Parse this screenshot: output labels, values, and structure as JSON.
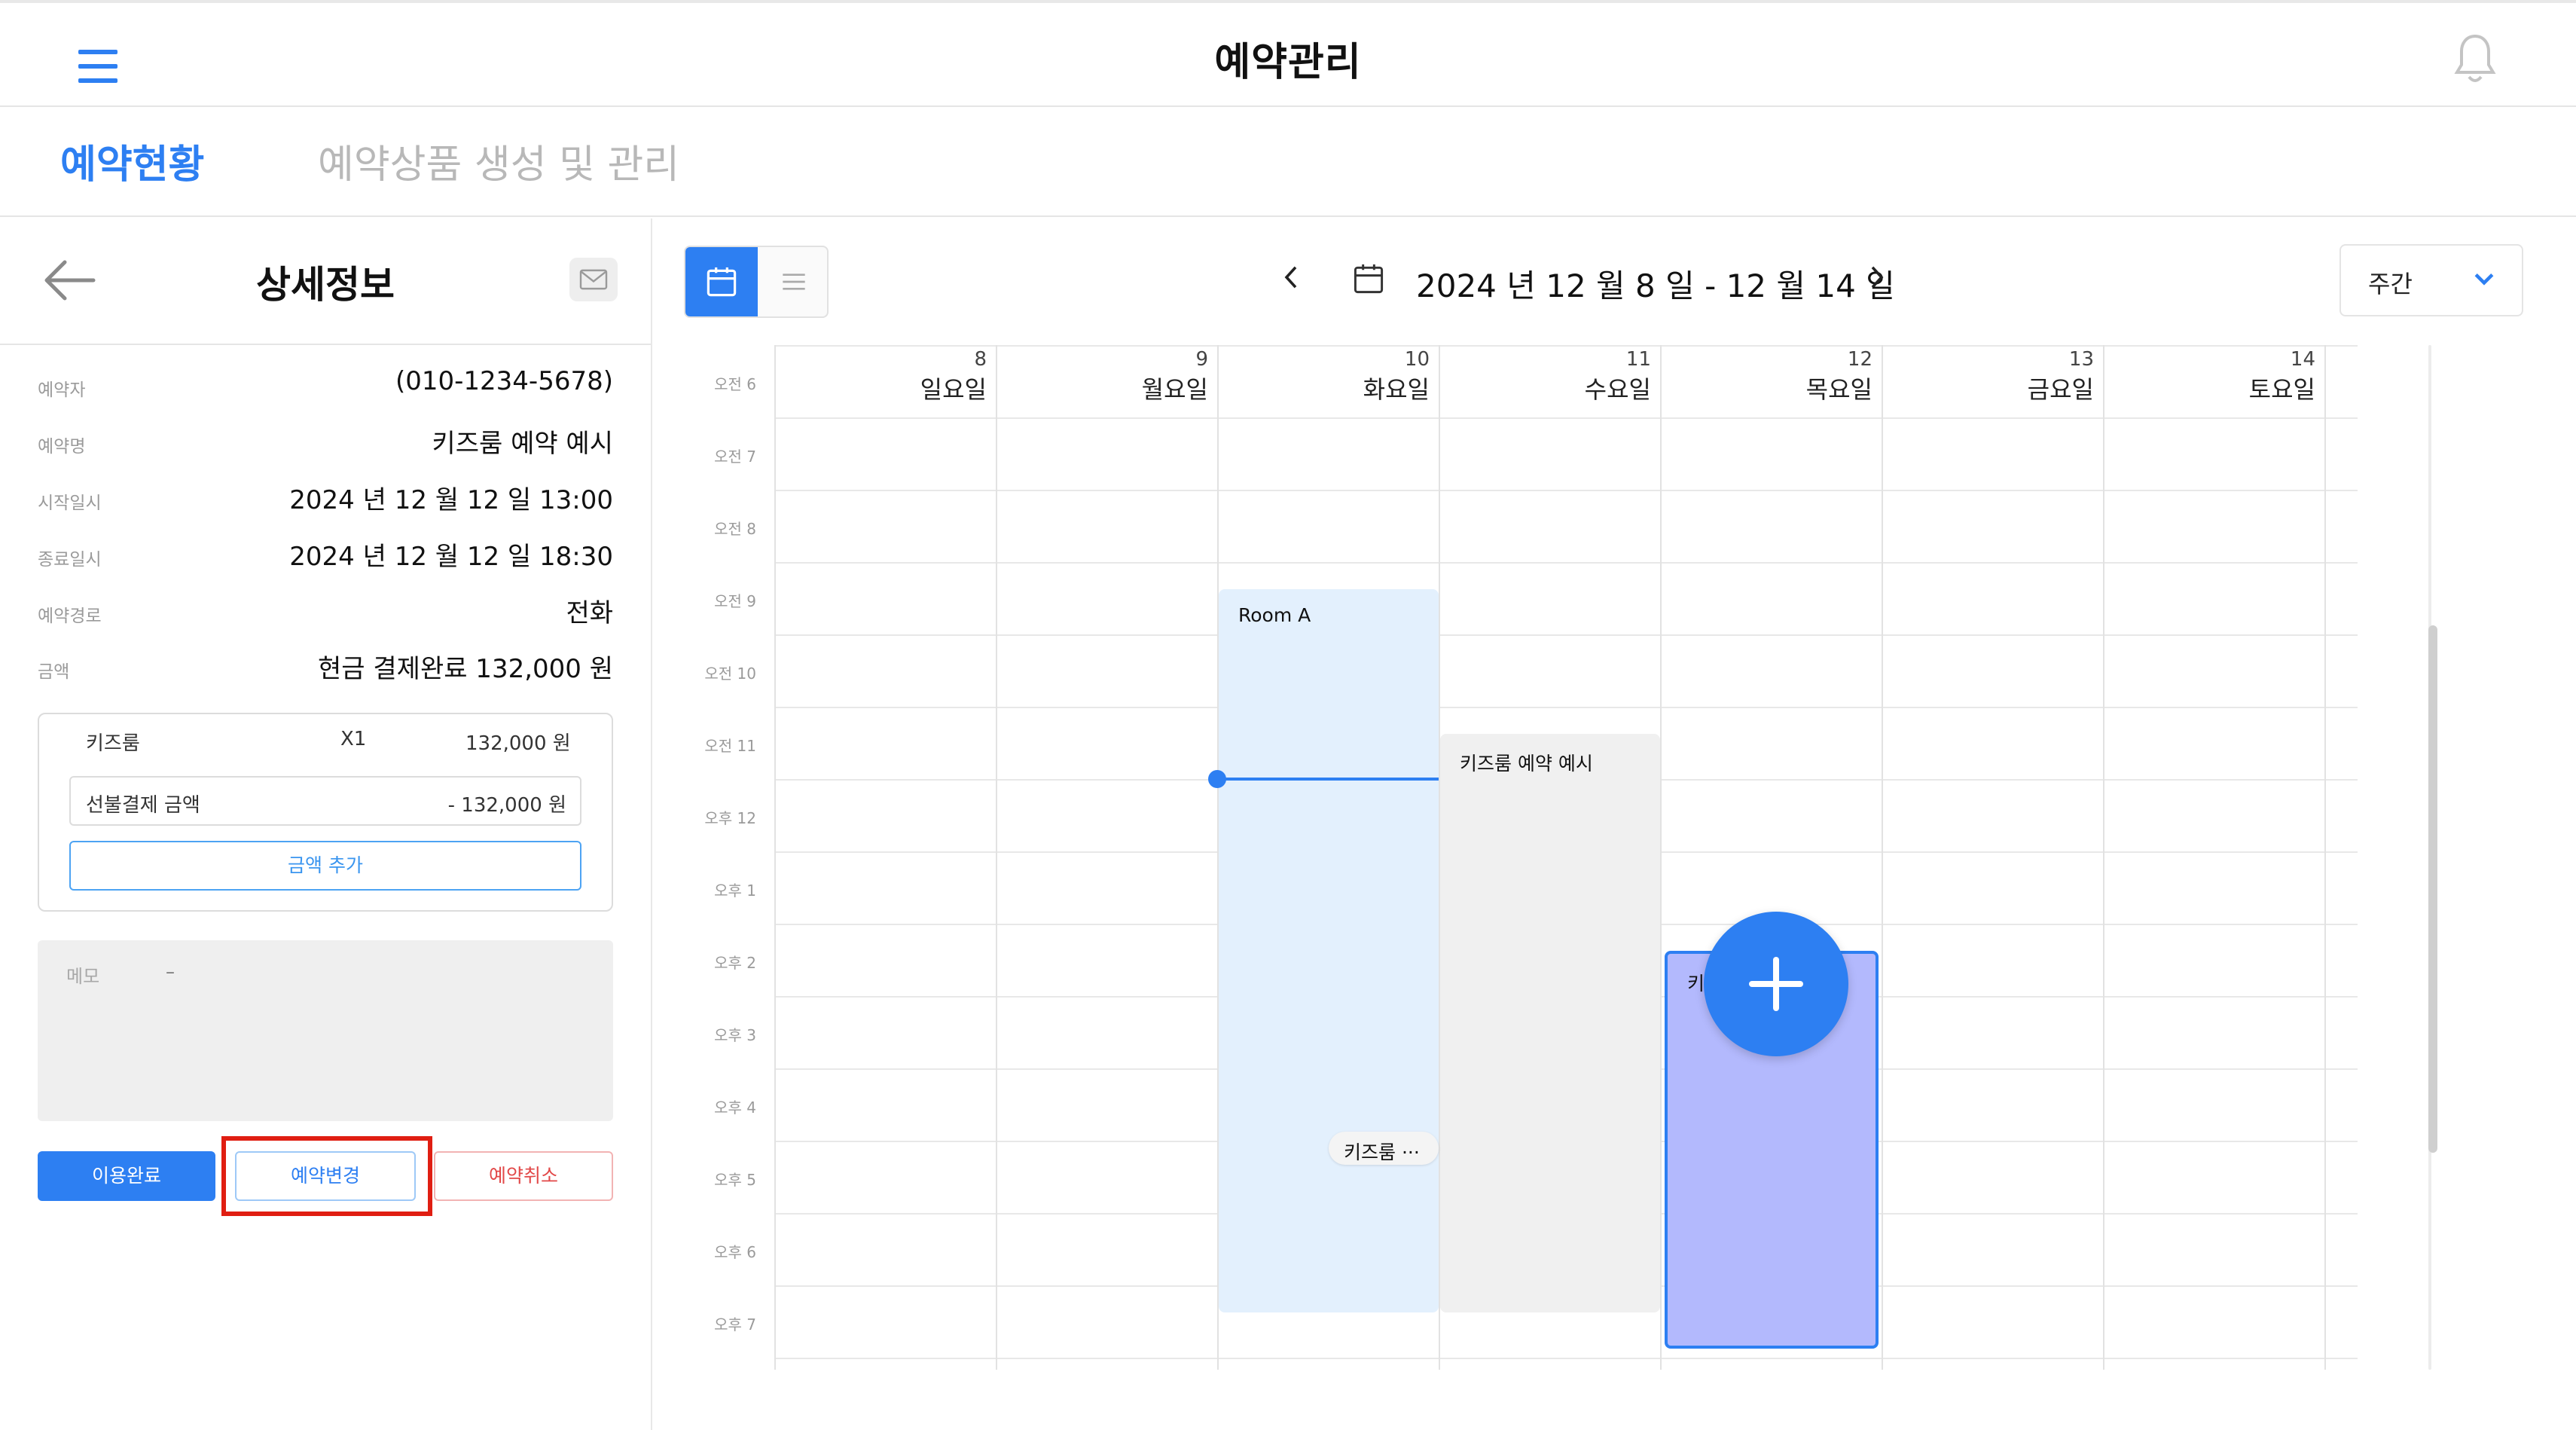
{
  "app": {
    "title": "예약관리"
  },
  "tabs": [
    {
      "label": "예약현황",
      "active": true
    },
    {
      "label": "예약상품 생성 및 관리",
      "active": false
    }
  ],
  "detail": {
    "title": "상세정보",
    "rows": [
      {
        "label": "예약자",
        "value": "(010-1234-5678)"
      },
      {
        "label": "예약명",
        "value": "키즈룸 예약 예시"
      },
      {
        "label": "시작일시",
        "value": "2024 년 12 월 12 일 13:00"
      },
      {
        "label": "종료일시",
        "value": "2024 년 12 월 12 일 18:30"
      },
      {
        "label": "예약경로",
        "value": "전화"
      },
      {
        "label": "금액",
        "value": "현금 결제완료 132,000 원"
      }
    ],
    "price": {
      "item_name": "키즈룸",
      "item_qty": "X1",
      "item_amount": "132,000 원",
      "prepaid_label": "선불결제 금액",
      "prepaid_amount": "- 132,000 원",
      "add_button": "금액 추가"
    },
    "memo": {
      "label": "메모",
      "value": "–"
    },
    "actions": {
      "complete": "이용완료",
      "change": "예약변경",
      "cancel": "예약취소"
    }
  },
  "calendar": {
    "date_range": "2024 년 12 월 8 일 - 12 월 14 일",
    "period": "주간",
    "days": [
      {
        "num": "8",
        "name": "일요일"
      },
      {
        "num": "9",
        "name": "월요일"
      },
      {
        "num": "10",
        "name": "화요일"
      },
      {
        "num": "11",
        "name": "수요일"
      },
      {
        "num": "12",
        "name": "목요일"
      },
      {
        "num": "13",
        "name": "금요일"
      },
      {
        "num": "14",
        "name": "토요일"
      }
    ],
    "hours": [
      "오전 6",
      "오전 7",
      "오전 8",
      "오전 9",
      "오전 10",
      "오전 11",
      "오후 12",
      "오후 1",
      "오후 2",
      "오후 3",
      "오후 4",
      "오후 5",
      "오후 6",
      "오후 7"
    ],
    "events": [
      {
        "title": "Room A",
        "day": 2,
        "start": 8.0,
        "end": 18.0,
        "color": "#e3f0fd"
      },
      {
        "title": "키즈룸 예약 예시",
        "day": 3,
        "start": 10.0,
        "end": 18.0,
        "color": "#f0f0f0"
      },
      {
        "title": "키즈룸 예약 예시",
        "day": 4,
        "start": 13.0,
        "end": 18.5,
        "color": "#b3b9fd"
      },
      {
        "title": "키즈룸 ···",
        "day": 2,
        "start": 15.5,
        "end": 15.9,
        "color": "#f4f4f4"
      }
    ],
    "now_time": 10.6
  },
  "colors": {
    "accent": "#2d7ff2",
    "danger": "#e24848",
    "highlight": "#e01e12"
  }
}
